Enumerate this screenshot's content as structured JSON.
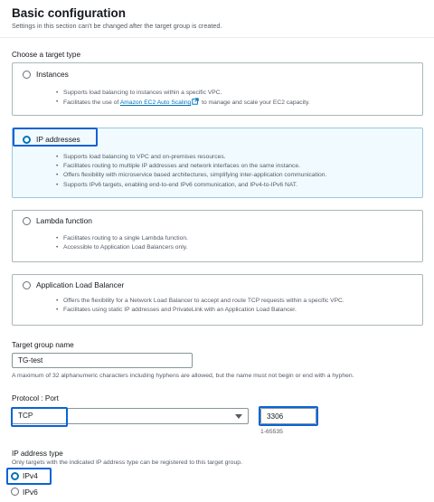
{
  "header": {
    "title": "Basic configuration",
    "subtitle": "Settings in this section can't be changed after the target group is created."
  },
  "target_type": {
    "label": "Choose a target type",
    "options": [
      {
        "label": "Instances",
        "selected": false,
        "bullets": [
          "Supports load balancing to instances within a specific VPC."
        ],
        "autoscaling_pre": "Facilitates the use of ",
        "autoscaling_link": "Amazon EC2 Auto Scaling",
        "autoscaling_post": " to manage and scale your EC2 capacity."
      },
      {
        "label": "IP addresses",
        "selected": true,
        "bullets": [
          "Supports load balancing to VPC and on-premises resources.",
          "Facilitates routing to multiple IP addresses and network interfaces on the same instance.",
          "Offers flexibility with microservice based architectures, simplifying inter-application communication.",
          "Supports IPv6 targets, enabling end-to-end IPv6 communication, and IPv4-to-IPv6 NAT."
        ]
      },
      {
        "label": "Lambda function",
        "selected": false,
        "bullets": [
          "Facilitates routing to a single Lambda function.",
          "Accessible to Application Load Balancers only."
        ]
      },
      {
        "label": "Application Load Balancer",
        "selected": false,
        "bullets": [
          "Offers the flexibility for a Network Load Balancer to accept and route TCP requests within a specific VPC.",
          "Facilitates using static IP addresses and PrivateLink with an Application Load Balancer."
        ]
      }
    ]
  },
  "target_group_name": {
    "label": "Target group name",
    "value": "TG-test",
    "hint": "A maximum of 32 alphanumeric characters including hyphens are allowed, but the name must not begin or end with a hyphen."
  },
  "protocol_port": {
    "label": "Protocol : Port",
    "protocol": "TCP",
    "port": "3306",
    "port_hint": "1-65535"
  },
  "ip_address_type": {
    "label": "IP address type",
    "description": "Only targets with the indicated IP address type can be registered to this target group.",
    "options": [
      {
        "label": "IPv4",
        "selected": true
      },
      {
        "label": "IPv6",
        "selected": false
      }
    ]
  },
  "colors": {
    "highlight": "#0a63d6",
    "radio_checked": "#0073bb",
    "selected_card_bg": "#f1faff",
    "link": "#0073bb"
  }
}
